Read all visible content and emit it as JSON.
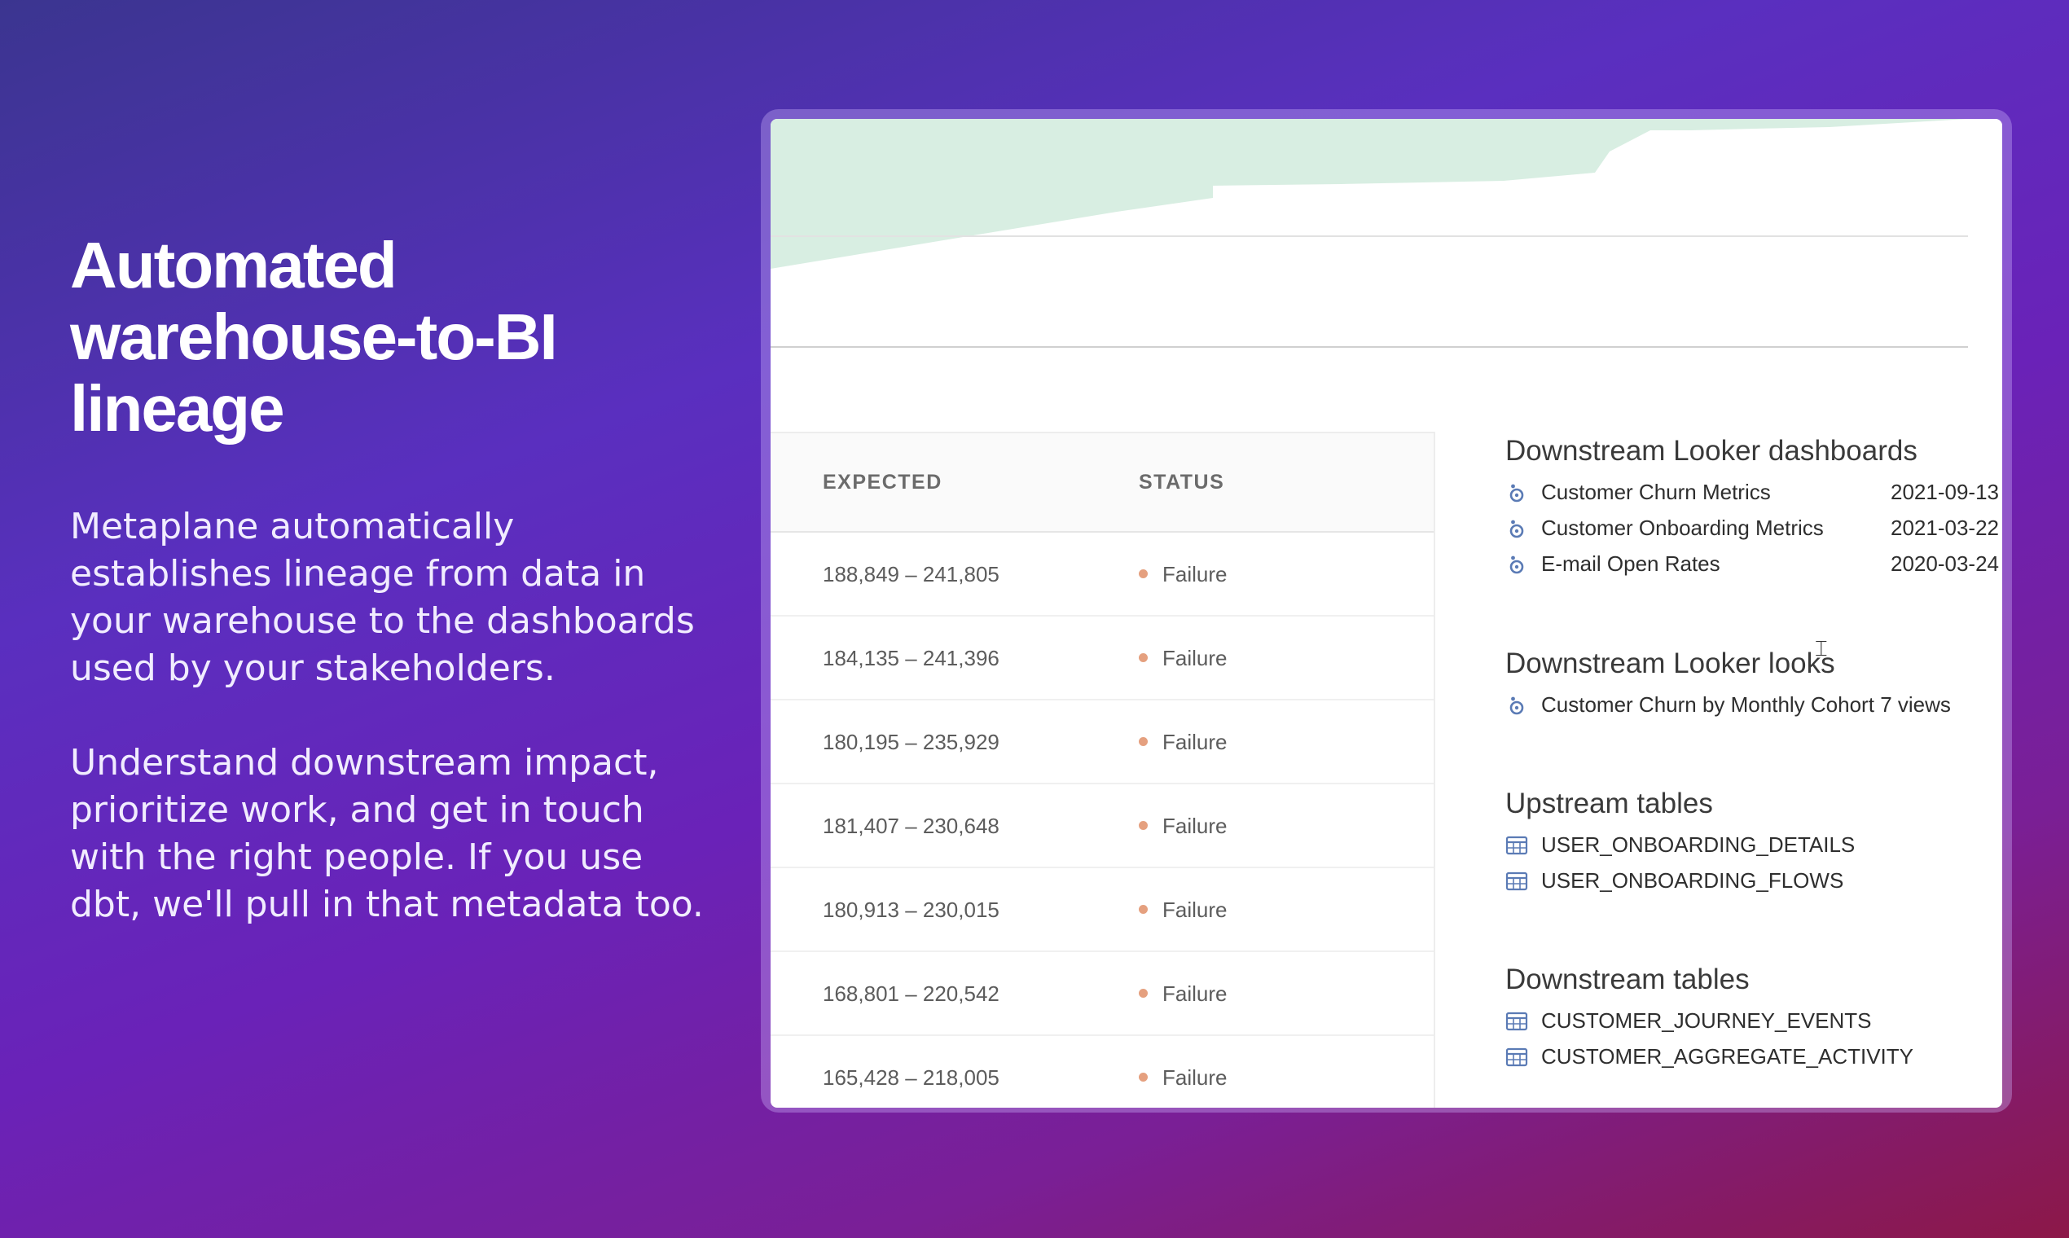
{
  "hero": {
    "title_lines": [
      "Automated",
      "warehouse-to-BI",
      "lineage"
    ],
    "paragraph1": "Metaplane automatically establishes lineage from data in your warehouse to the dashboards used by your stakeholders.",
    "paragraph2": "Understand downstream impact, prioritize work, and get in touch with the right people. If you use dbt, we'll pull in that metadata too."
  },
  "colors": {
    "chart_fill": "#d8eee2",
    "status_dot": "#e5a07f",
    "icon_blue": "#5b7bb5"
  },
  "table": {
    "columns": [
      "EXPECTED",
      "STATUS"
    ],
    "rows": [
      {
        "expected": "188,849 – 241,805",
        "status": "Failure"
      },
      {
        "expected": "184,135 – 241,396",
        "status": "Failure"
      },
      {
        "expected": "180,195 – 235,929",
        "status": "Failure"
      },
      {
        "expected": "181,407 – 230,648",
        "status": "Failure"
      },
      {
        "expected": "180,913 – 230,015",
        "status": "Failure"
      },
      {
        "expected": "168,801 – 220,542",
        "status": "Failure"
      },
      {
        "expected": "165,428 – 218,005",
        "status": "Failure"
      }
    ]
  },
  "lineage": {
    "dashboards": {
      "title": "Downstream Looker dashboards",
      "icon": "looker-icon",
      "items": [
        {
          "name": "Customer Churn Metrics",
          "date": "2021-09-13"
        },
        {
          "name": "Customer Onboarding Metrics",
          "date": "2021-03-22"
        },
        {
          "name": "E-mail Open Rates",
          "date": "2020-03-24"
        }
      ]
    },
    "looks": {
      "title": "Downstream Looker looks",
      "icon": "looker-icon",
      "items": [
        {
          "name": "Customer Churn by Monthly Cohort",
          "meta": "7 views"
        }
      ]
    },
    "upstream_tables": {
      "title": "Upstream tables",
      "icon": "table-icon",
      "items": [
        "USER_ONBOARDING_DETAILS",
        "USER_ONBOARDING_FLOWS"
      ]
    },
    "downstream_tables": {
      "title": "Downstream tables",
      "icon": "table-icon",
      "items": [
        "CUSTOMER_JOURNEY_EVENTS",
        "CUSTOMER_AGGREGATE_ACTIVITY"
      ]
    }
  }
}
